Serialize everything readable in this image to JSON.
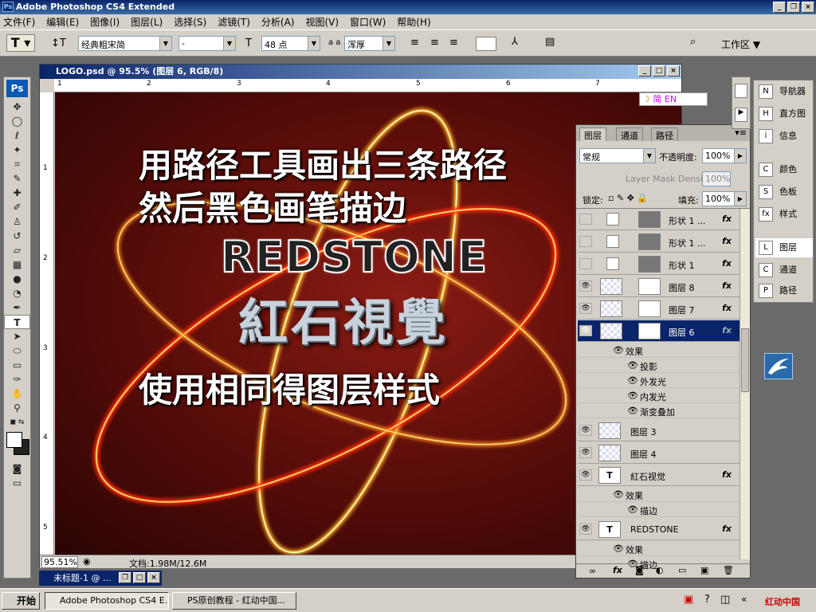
{
  "app": {
    "title": "Adobe Photoshop CS4 Extended",
    "ps": "Ps"
  },
  "menu": [
    "文件(F)",
    "编辑(E)",
    "图像(I)",
    "图层(L)",
    "选择(S)",
    "滤镜(T)",
    "分析(A)",
    "视图(V)",
    "窗口(W)",
    "帮助(H)"
  ],
  "options": {
    "font_family": "经典粗宋简",
    "font_style": "-",
    "font_size": "48 点",
    "aa_label": "a a",
    "aa_mode": "浑厚",
    "workspace": "工作区 ▼"
  },
  "toolbox": {
    "badge": "Ps"
  },
  "document": {
    "title": "LOGO.psd @ 95.5% (图层 6, RGB/8)",
    "zoom": "95.51%",
    "doc_size": "文档:1.98M/12.6M",
    "ruler_h": [
      "1",
      "2",
      "3",
      "4",
      "5",
      "6",
      "7"
    ],
    "ruler_v": [
      "1",
      "2",
      "3",
      "4",
      "5"
    ]
  },
  "canvas": {
    "line1": "用路径工具画出三条路径",
    "line2": "然后黑色画笔描边",
    "brand_en": "REDSTONE",
    "brand_cn": "紅石視覺",
    "line3": "使用相同得图层样式"
  },
  "ime": {
    "text": "简 EN"
  },
  "minimized": {
    "title": "未标题-1 @ ..."
  },
  "layers_panel": {
    "tabs": [
      "图层",
      "通道",
      "路径"
    ],
    "blend": "常规",
    "opacity_label": "不透明度:",
    "opacity": "100%",
    "density_label": "Layer Mask Density",
    "density": "100%",
    "lock_label": "锁定:",
    "fill_label": "填充:",
    "fill": "100%",
    "layers": [
      {
        "name": "形状 1 ...",
        "visible": false,
        "fx": "fx"
      },
      {
        "name": "形状 1 ...",
        "visible": false,
        "fx": "fx"
      },
      {
        "name": "形状 1",
        "visible": false,
        "fx": "fx"
      },
      {
        "name": "图层 8",
        "visible": true,
        "fx": "fx"
      },
      {
        "name": "图层 7",
        "visible": true,
        "fx": "fx"
      },
      {
        "name": "图层 6",
        "visible": true,
        "fx": "fx",
        "selected": true
      }
    ],
    "effects_label": "效果",
    "effects": [
      "投影",
      "外发光",
      "内发光",
      "渐变叠加"
    ],
    "layers2": [
      "图层 3",
      "图层 4"
    ],
    "text_layers": [
      {
        "name": "紅石视觉",
        "fx": "fx",
        "effect": "描边"
      },
      {
        "name": "REDSTONE",
        "fx": "fx",
        "effect": "描边"
      }
    ]
  },
  "right_panel": [
    {
      "label": "导航器",
      "icon": "N"
    },
    {
      "label": "直方图",
      "icon": "H"
    },
    {
      "label": "信息",
      "icon": "i"
    },
    {
      "label": "颜色",
      "icon": "C"
    },
    {
      "label": "色板",
      "icon": "S"
    },
    {
      "label": "样式",
      "icon": "fx"
    },
    {
      "label": "图层",
      "icon": "L"
    },
    {
      "label": "通道",
      "icon": "C"
    },
    {
      "label": "路径",
      "icon": "P"
    }
  ],
  "taskbar": {
    "start": "开始",
    "tasks": [
      "Adobe Photoshop CS4 E...",
      "PS原创教程 - 红动中国..."
    ],
    "tray": "红动中国"
  }
}
